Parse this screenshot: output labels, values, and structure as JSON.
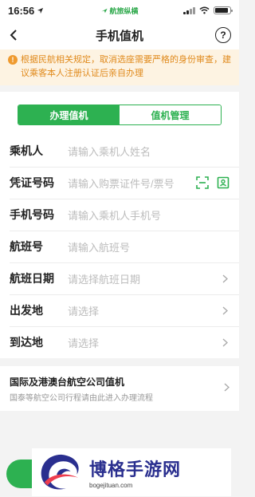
{
  "status_bar": {
    "time": "16:56",
    "carrier": "航旅纵横"
  },
  "nav": {
    "title": "手机值机"
  },
  "notice": {
    "text": "根据民航相关规定，取消选座需要严格的身份审查，建议乘客本人注册认证后亲自办理"
  },
  "tabs": [
    {
      "label": "办理值机",
      "active": true
    },
    {
      "label": "值机管理",
      "active": false
    }
  ],
  "form": {
    "passenger": {
      "label": "乘机人",
      "placeholder": "请输入乘机人姓名"
    },
    "id_number": {
      "label": "凭证号码",
      "placeholder": "请输入购票证件号/票号"
    },
    "phone": {
      "label": "手机号码",
      "placeholder": "请输入乘机人手机号"
    },
    "flight_no": {
      "label": "航班号",
      "placeholder": "请输入航班号"
    },
    "flight_date": {
      "label": "航班日期",
      "placeholder": "请选择航班日期"
    },
    "departure": {
      "label": "出发地",
      "placeholder": "请选择"
    },
    "arrival": {
      "label": "到达地",
      "placeholder": "请选择"
    }
  },
  "international": {
    "title": "国际及港澳台航空公司值机",
    "subtitle": "国泰等航空公司行程请由此进入办理流程"
  },
  "watermark": {
    "name": "博格手游网",
    "url": "bogejituan.com"
  },
  "colors": {
    "accent": "#2db151",
    "notice_bg": "#fdf3e2",
    "notice_text": "#e08a1c"
  },
  "icons": [
    "back-icon",
    "help-icon",
    "warning-icon",
    "scan-icon",
    "id-card-icon",
    "chevron-right-icon"
  ]
}
